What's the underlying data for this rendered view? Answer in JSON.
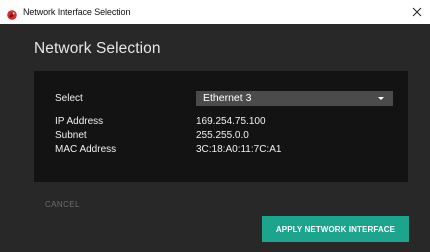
{
  "window": {
    "title": "Network Interface Selection",
    "app_icon": "red-circle-app-icon",
    "close_icon": "close-x-icon"
  },
  "dialog": {
    "heading": "Network Selection",
    "select": {
      "label": "Select",
      "value": "Ethernet 3",
      "chevron_icon": "chevron-down-icon"
    },
    "fields": [
      {
        "label": "IP Address",
        "value": "169.254.75.100"
      },
      {
        "label": "Subnet",
        "value": "255.255.0.0"
      },
      {
        "label": "MAC Address",
        "value": "3C:18:A0:11:7C:A1"
      }
    ]
  },
  "actions": {
    "cancel_label": "CANCEL",
    "apply_label": "APPLY NETWORK INTERFACE"
  },
  "colors": {
    "background": "#282828",
    "panel": "#131313",
    "accent": "#1ca48c",
    "app_icon": "#d42a2a"
  }
}
